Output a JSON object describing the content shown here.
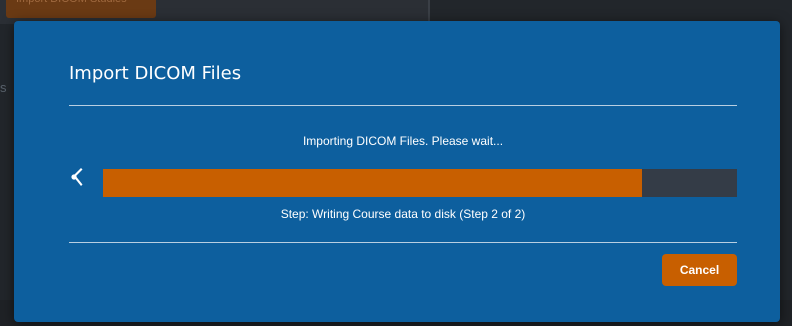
{
  "background": {
    "toolbar_button_label": "Import DICOM Studies",
    "side_text": "s"
  },
  "dialog": {
    "title": "Import DICOM Files",
    "status_message": "Importing DICOM Files. Please wait...",
    "progress_fraction": 0.85,
    "step_message": "Step: Writing Course data to disk (Step 2 of 2)",
    "cancel_label": "Cancel"
  },
  "icons": {
    "spinner": "loading-spinner-icon"
  },
  "colors": {
    "dialog_background": "#0d5f9e",
    "progress_fill": "#c85f00",
    "progress_track": "#343c47",
    "button": "#c85f00"
  }
}
